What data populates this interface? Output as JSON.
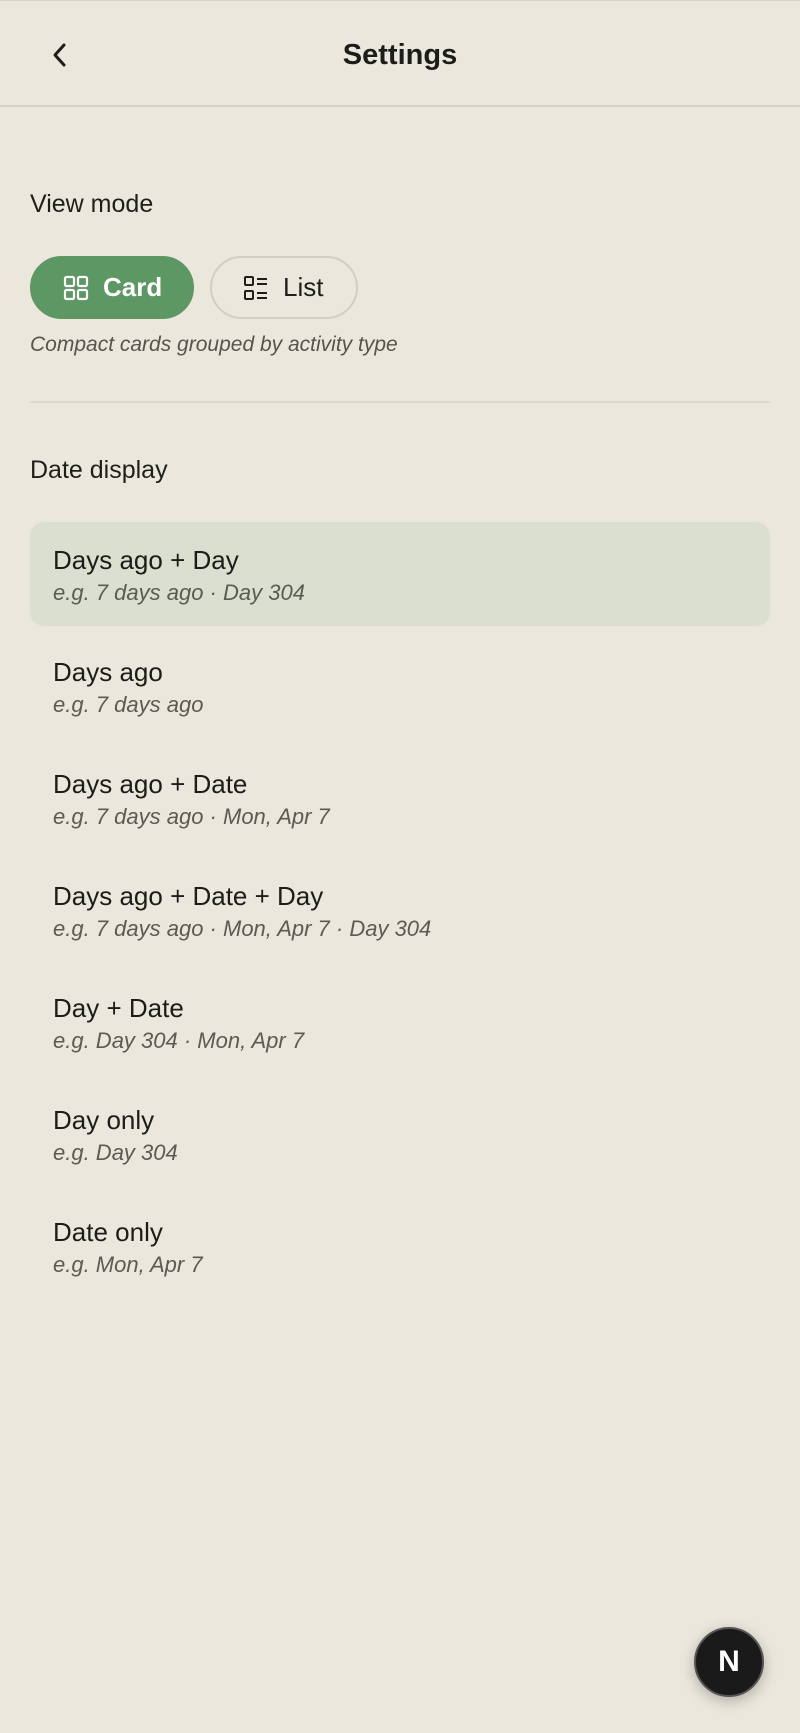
{
  "header": {
    "title": "Settings",
    "back_icon": "chevron-left-icon"
  },
  "view_mode": {
    "label": "View mode",
    "options": [
      {
        "label": "Card",
        "icon": "grid-icon",
        "selected": true
      },
      {
        "label": "List",
        "icon": "list-icon",
        "selected": false
      }
    ],
    "hint": "Compact cards grouped by activity type"
  },
  "date_display": {
    "label": "Date display",
    "options": [
      {
        "title": "Days ago + Day",
        "example": "e.g. 7 days ago · Day 304",
        "selected": true
      },
      {
        "title": "Days ago",
        "example": "e.g. 7 days ago",
        "selected": false
      },
      {
        "title": "Days ago + Date",
        "example": "e.g. 7 days ago · Mon, Apr 7",
        "selected": false
      },
      {
        "title": "Days ago + Date + Day",
        "example": "e.g. 7 days ago · Mon, Apr 7 · Day 304",
        "selected": false
      },
      {
        "title": "Day + Date",
        "example": "e.g. Day 304 · Mon, Apr 7",
        "selected": false
      },
      {
        "title": "Day only",
        "example": "e.g. Day 304",
        "selected": false
      },
      {
        "title": "Date only",
        "example": "e.g. Mon, Apr 7",
        "selected": false
      }
    ]
  },
  "badge": {
    "label": "N"
  },
  "colors": {
    "background": "#ebe7dc",
    "accent": "#5d9764",
    "selected_row": "#dadfcf"
  }
}
